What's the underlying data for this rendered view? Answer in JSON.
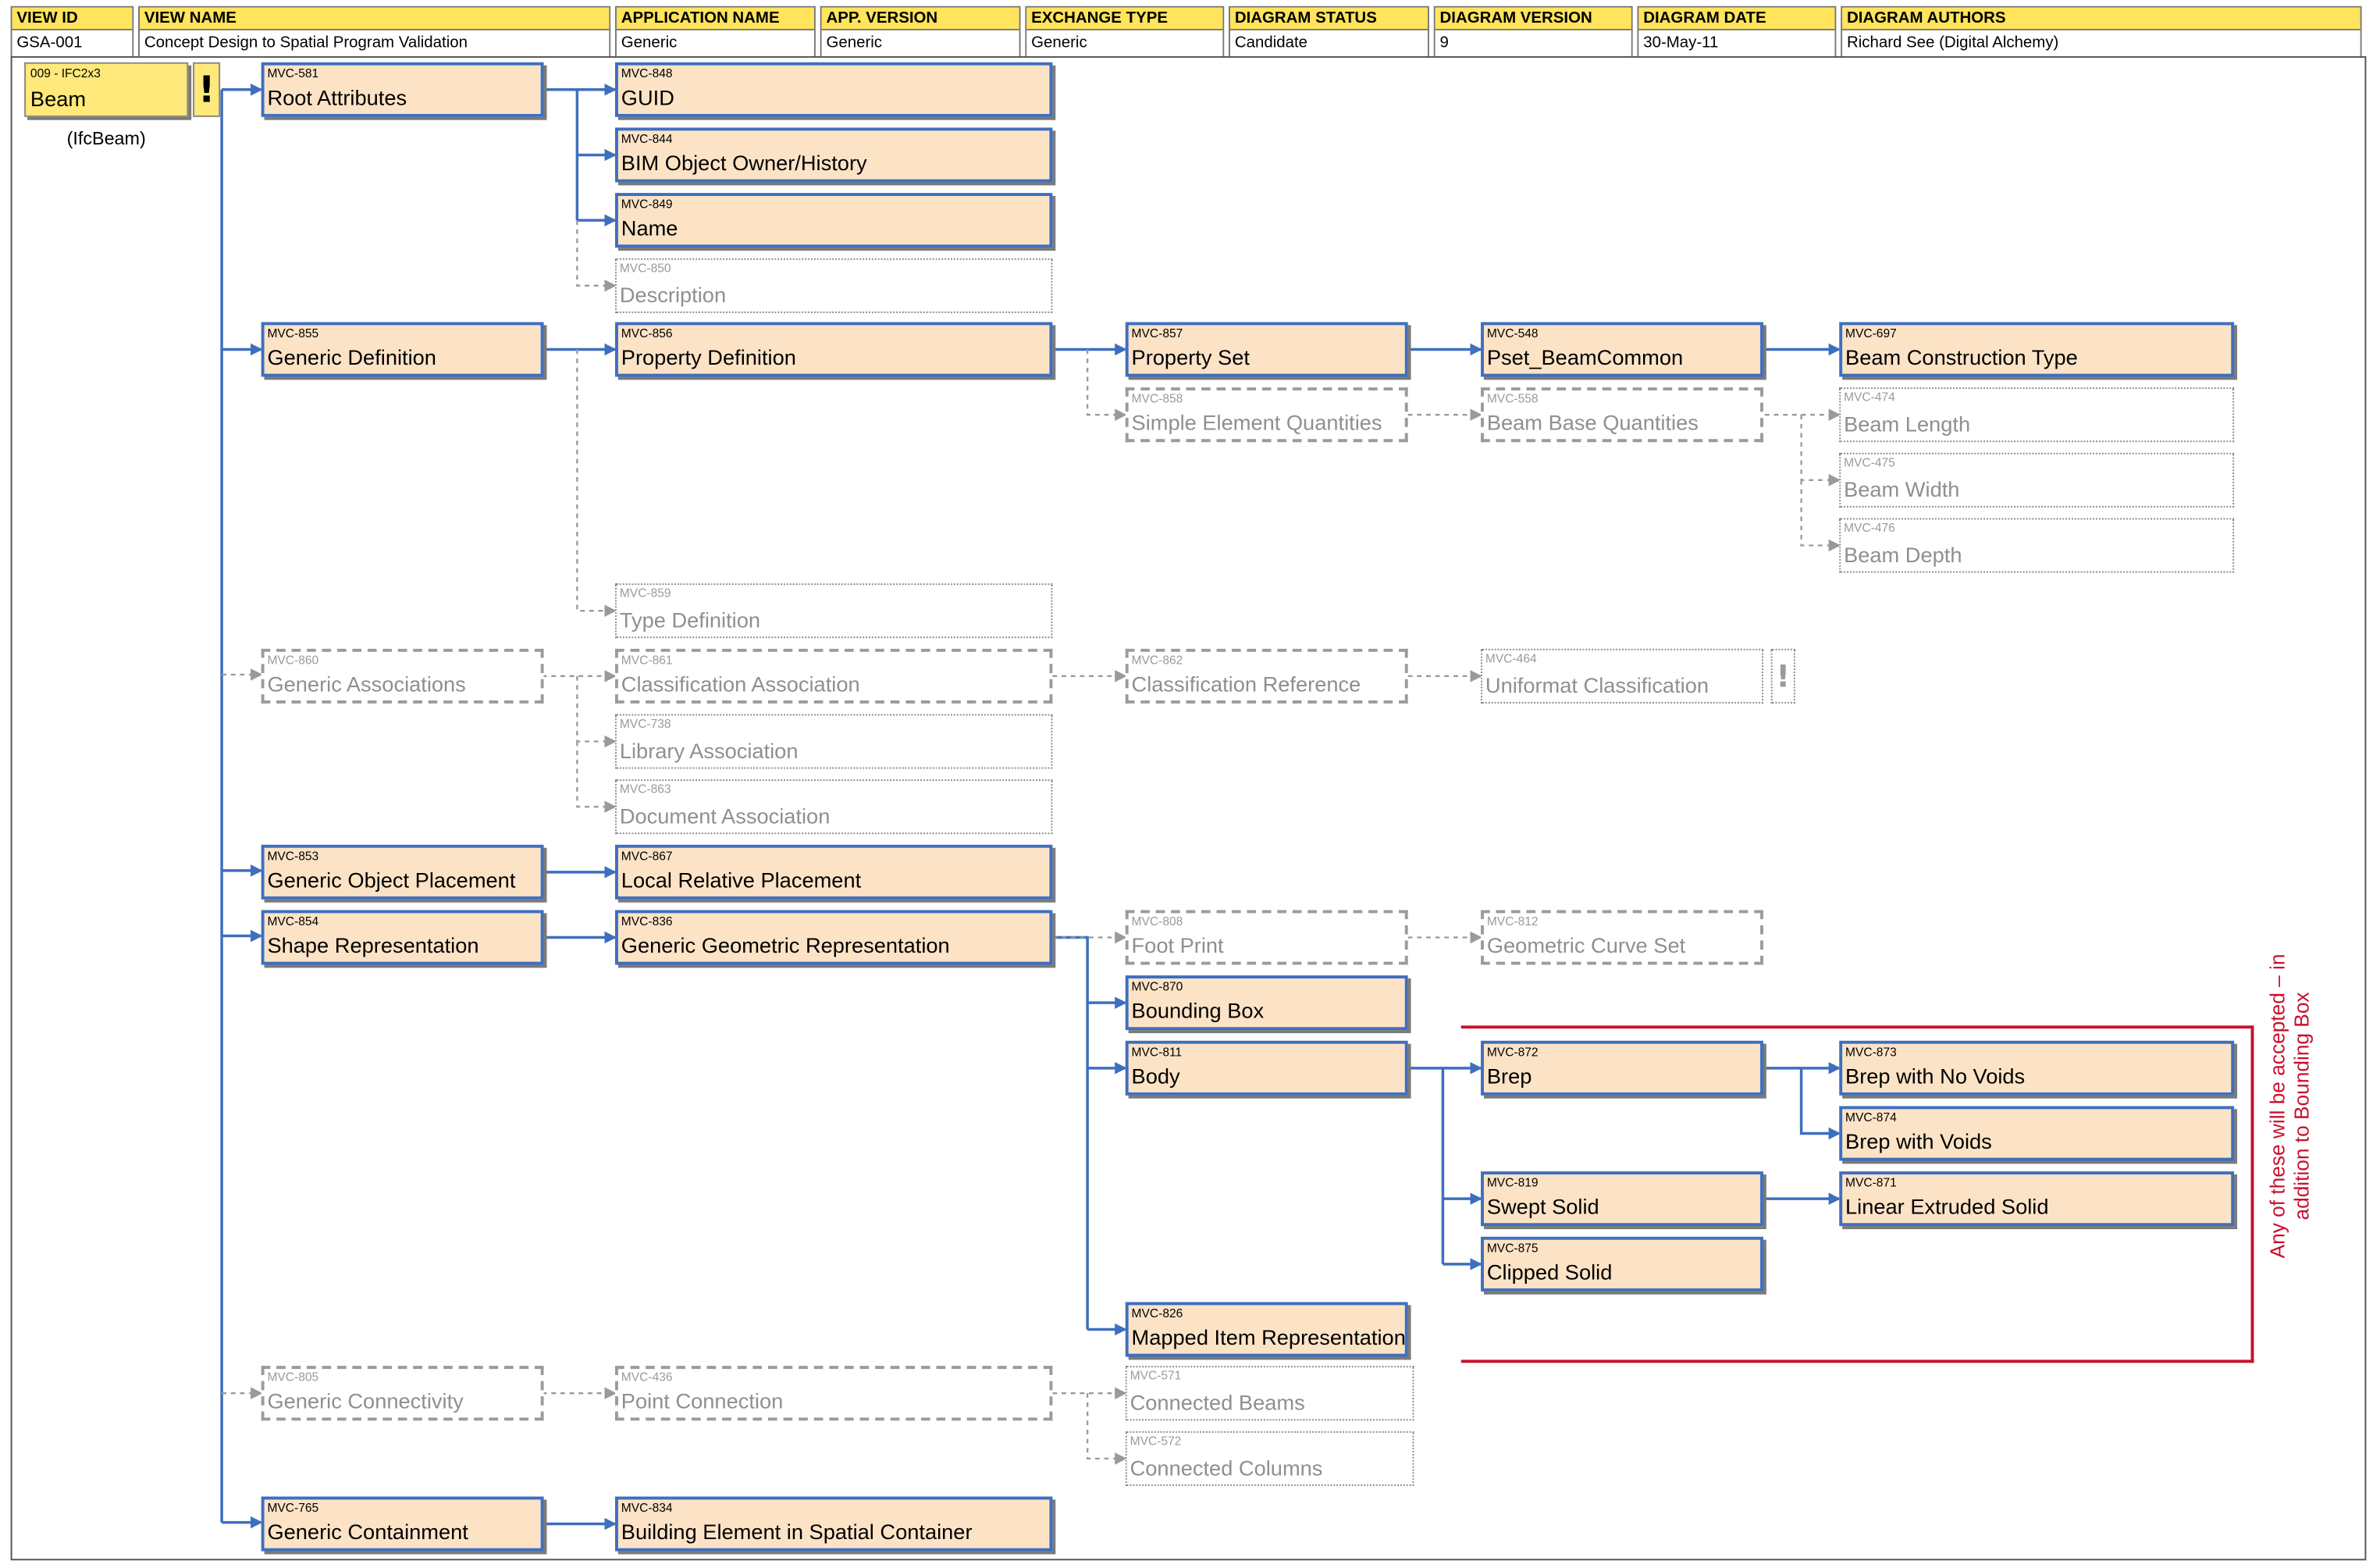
{
  "header": [
    {
      "title": "VIEW ID",
      "value": "GSA-001"
    },
    {
      "title": "VIEW NAME",
      "value": "Concept Design to Spatial Program Validation"
    },
    {
      "title": "APPLICATION NAME",
      "value": "Generic"
    },
    {
      "title": "APP. VERSION",
      "value": "Generic"
    },
    {
      "title": "EXCHANGE TYPE",
      "value": "Generic"
    },
    {
      "title": "DIAGRAM STATUS",
      "value": "Candidate"
    },
    {
      "title": "DIAGRAM VERSION",
      "value": "9"
    },
    {
      "title": "DIAGRAM DATE",
      "value": "30-May-11"
    },
    {
      "title": "DIAGRAM AUTHORS",
      "value": "Richard See (Digital Alchemy)"
    }
  ],
  "entity": {
    "id": "009 - IFC2x3",
    "name": "Beam",
    "ifc_class": "(IfcBeam)",
    "flag": "!"
  },
  "nodes": [
    {
      "id": "MVC-581",
      "name": "Root Attributes",
      "status": "required"
    },
    {
      "id": "MVC-848",
      "name": "GUID",
      "status": "required"
    },
    {
      "id": "MVC-844",
      "name": "BIM Object Owner/History",
      "status": "required"
    },
    {
      "id": "MVC-849",
      "name": "Name",
      "status": "required"
    },
    {
      "id": "MVC-850",
      "name": "Description",
      "status": "optional"
    },
    {
      "id": "MVC-855",
      "name": "Generic Definition",
      "status": "required"
    },
    {
      "id": "MVC-856",
      "name": "Property Definition",
      "status": "required"
    },
    {
      "id": "MVC-857",
      "name": "Property Set",
      "status": "required"
    },
    {
      "id": "MVC-548",
      "name": "Pset_BeamCommon",
      "status": "required"
    },
    {
      "id": "MVC-697",
      "name": "Beam Construction Type",
      "status": "required"
    },
    {
      "id": "MVC-858",
      "name": "Simple Element Quantities",
      "status": "optional-dashed"
    },
    {
      "id": "MVC-558",
      "name": "Beam Base Quantities",
      "status": "optional-dashed"
    },
    {
      "id": "MVC-474",
      "name": "Beam Length",
      "status": "optional"
    },
    {
      "id": "MVC-475",
      "name": "Beam Width",
      "status": "optional"
    },
    {
      "id": "MVC-476",
      "name": "Beam Depth",
      "status": "optional"
    },
    {
      "id": "MVC-859",
      "name": "Type Definition",
      "status": "optional"
    },
    {
      "id": "MVC-860",
      "name": "Generic Associations",
      "status": "optional-dashed"
    },
    {
      "id": "MVC-861",
      "name": "Classification Association",
      "status": "optional-dashed"
    },
    {
      "id": "MVC-862",
      "name": "Classification Reference",
      "status": "optional-dashed"
    },
    {
      "id": "MVC-464",
      "name": "Uniformat Classification",
      "status": "optional"
    },
    {
      "id": "MVC-738",
      "name": "Library Association",
      "status": "optional"
    },
    {
      "id": "MVC-863",
      "name": "Document Association",
      "status": "optional"
    },
    {
      "id": "MVC-853",
      "name": "Generic Object Placement",
      "status": "required"
    },
    {
      "id": "MVC-867",
      "name": "Local Relative Placement",
      "status": "required"
    },
    {
      "id": "MVC-854",
      "name": "Shape Representation",
      "status": "required"
    },
    {
      "id": "MVC-836",
      "name": "Generic Geometric Representation",
      "status": "required"
    },
    {
      "id": "MVC-808",
      "name": "Foot Print",
      "status": "optional-dashed"
    },
    {
      "id": "MVC-812",
      "name": "Geometric Curve Set",
      "status": "optional-dashed"
    },
    {
      "id": "MVC-870",
      "name": "Bounding Box",
      "status": "required"
    },
    {
      "id": "MVC-811",
      "name": "Body",
      "status": "required"
    },
    {
      "id": "MVC-872",
      "name": "Brep",
      "status": "required"
    },
    {
      "id": "MVC-873",
      "name": "Brep with No Voids",
      "status": "required"
    },
    {
      "id": "MVC-874",
      "name": "Brep with Voids",
      "status": "required"
    },
    {
      "id": "MVC-819",
      "name": "Swept Solid",
      "status": "required"
    },
    {
      "id": "MVC-871",
      "name": "Linear Extruded Solid",
      "status": "required"
    },
    {
      "id": "MVC-875",
      "name": "Clipped Solid",
      "status": "required"
    },
    {
      "id": "MVC-826",
      "name": "Mapped Item Representation",
      "status": "required"
    },
    {
      "id": "MVC-805",
      "name": "Generic Connectivity",
      "status": "optional-dashed"
    },
    {
      "id": "MVC-436",
      "name": "Point Connection",
      "status": "optional-dashed"
    },
    {
      "id": "MVC-571",
      "name": "Connected Beams",
      "status": "optional"
    },
    {
      "id": "MVC-572",
      "name": "Connected Columns",
      "status": "optional"
    },
    {
      "id": "MVC-765",
      "name": "Generic Containment",
      "status": "required"
    },
    {
      "id": "MVC-834",
      "name": "Building Element in Spatial Container",
      "status": "required"
    }
  ],
  "uniformat_flag": "!",
  "note": "Any of these will be accepted – in addition to Bounding Box",
  "colors": {
    "required_fill": "#fde3c6",
    "required_border": "#3e6fbf",
    "optional": "#8f8f8f",
    "entity_fill": "#ffe97a",
    "header_fill": "#ffe45c",
    "note": "#c8102e"
  }
}
